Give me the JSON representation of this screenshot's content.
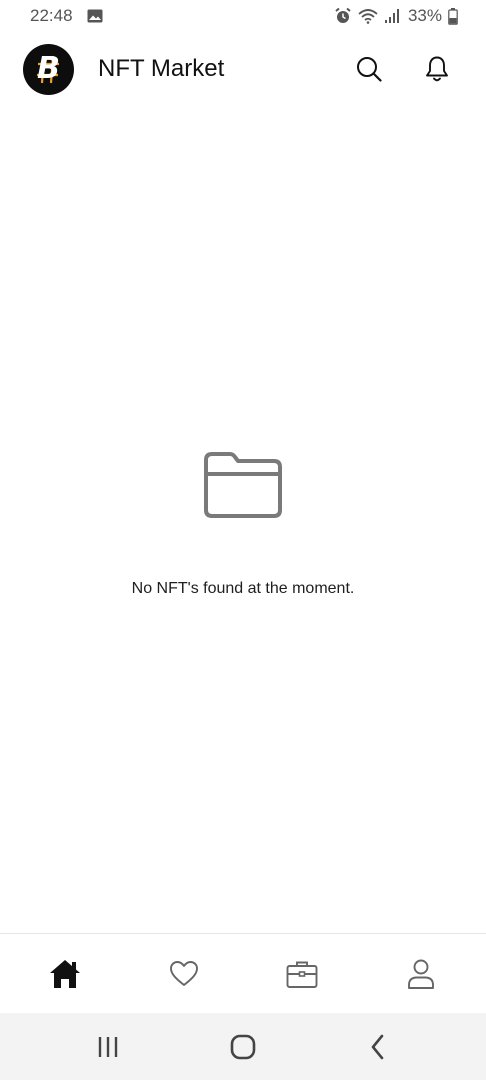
{
  "status_bar": {
    "time": "22:48",
    "battery": "33%",
    "icons": [
      "image-icon",
      "alarm-icon",
      "wifi-icon",
      "signal-icon",
      "battery-icon"
    ]
  },
  "header": {
    "title": "NFT Market",
    "logo_letter": "B",
    "icons": [
      "search-icon",
      "bell-icon"
    ]
  },
  "empty_state": {
    "icon": "folder-icon",
    "message": "No NFT's found at the moment."
  },
  "bottom_nav": {
    "items": [
      {
        "icon": "home-icon",
        "active": true
      },
      {
        "icon": "heart-icon",
        "active": false
      },
      {
        "icon": "briefcase-icon",
        "active": false
      },
      {
        "icon": "user-icon",
        "active": false
      }
    ]
  },
  "system_nav": {
    "items": [
      "recent-apps-icon",
      "home-circle-icon",
      "back-icon"
    ]
  },
  "colors": {
    "active_icon": "#111111",
    "inactive_icon": "#666666",
    "folder_icon": "#7a7a7a",
    "logo_bg": "#0d0d0d",
    "logo_accent": "#f0a020"
  }
}
